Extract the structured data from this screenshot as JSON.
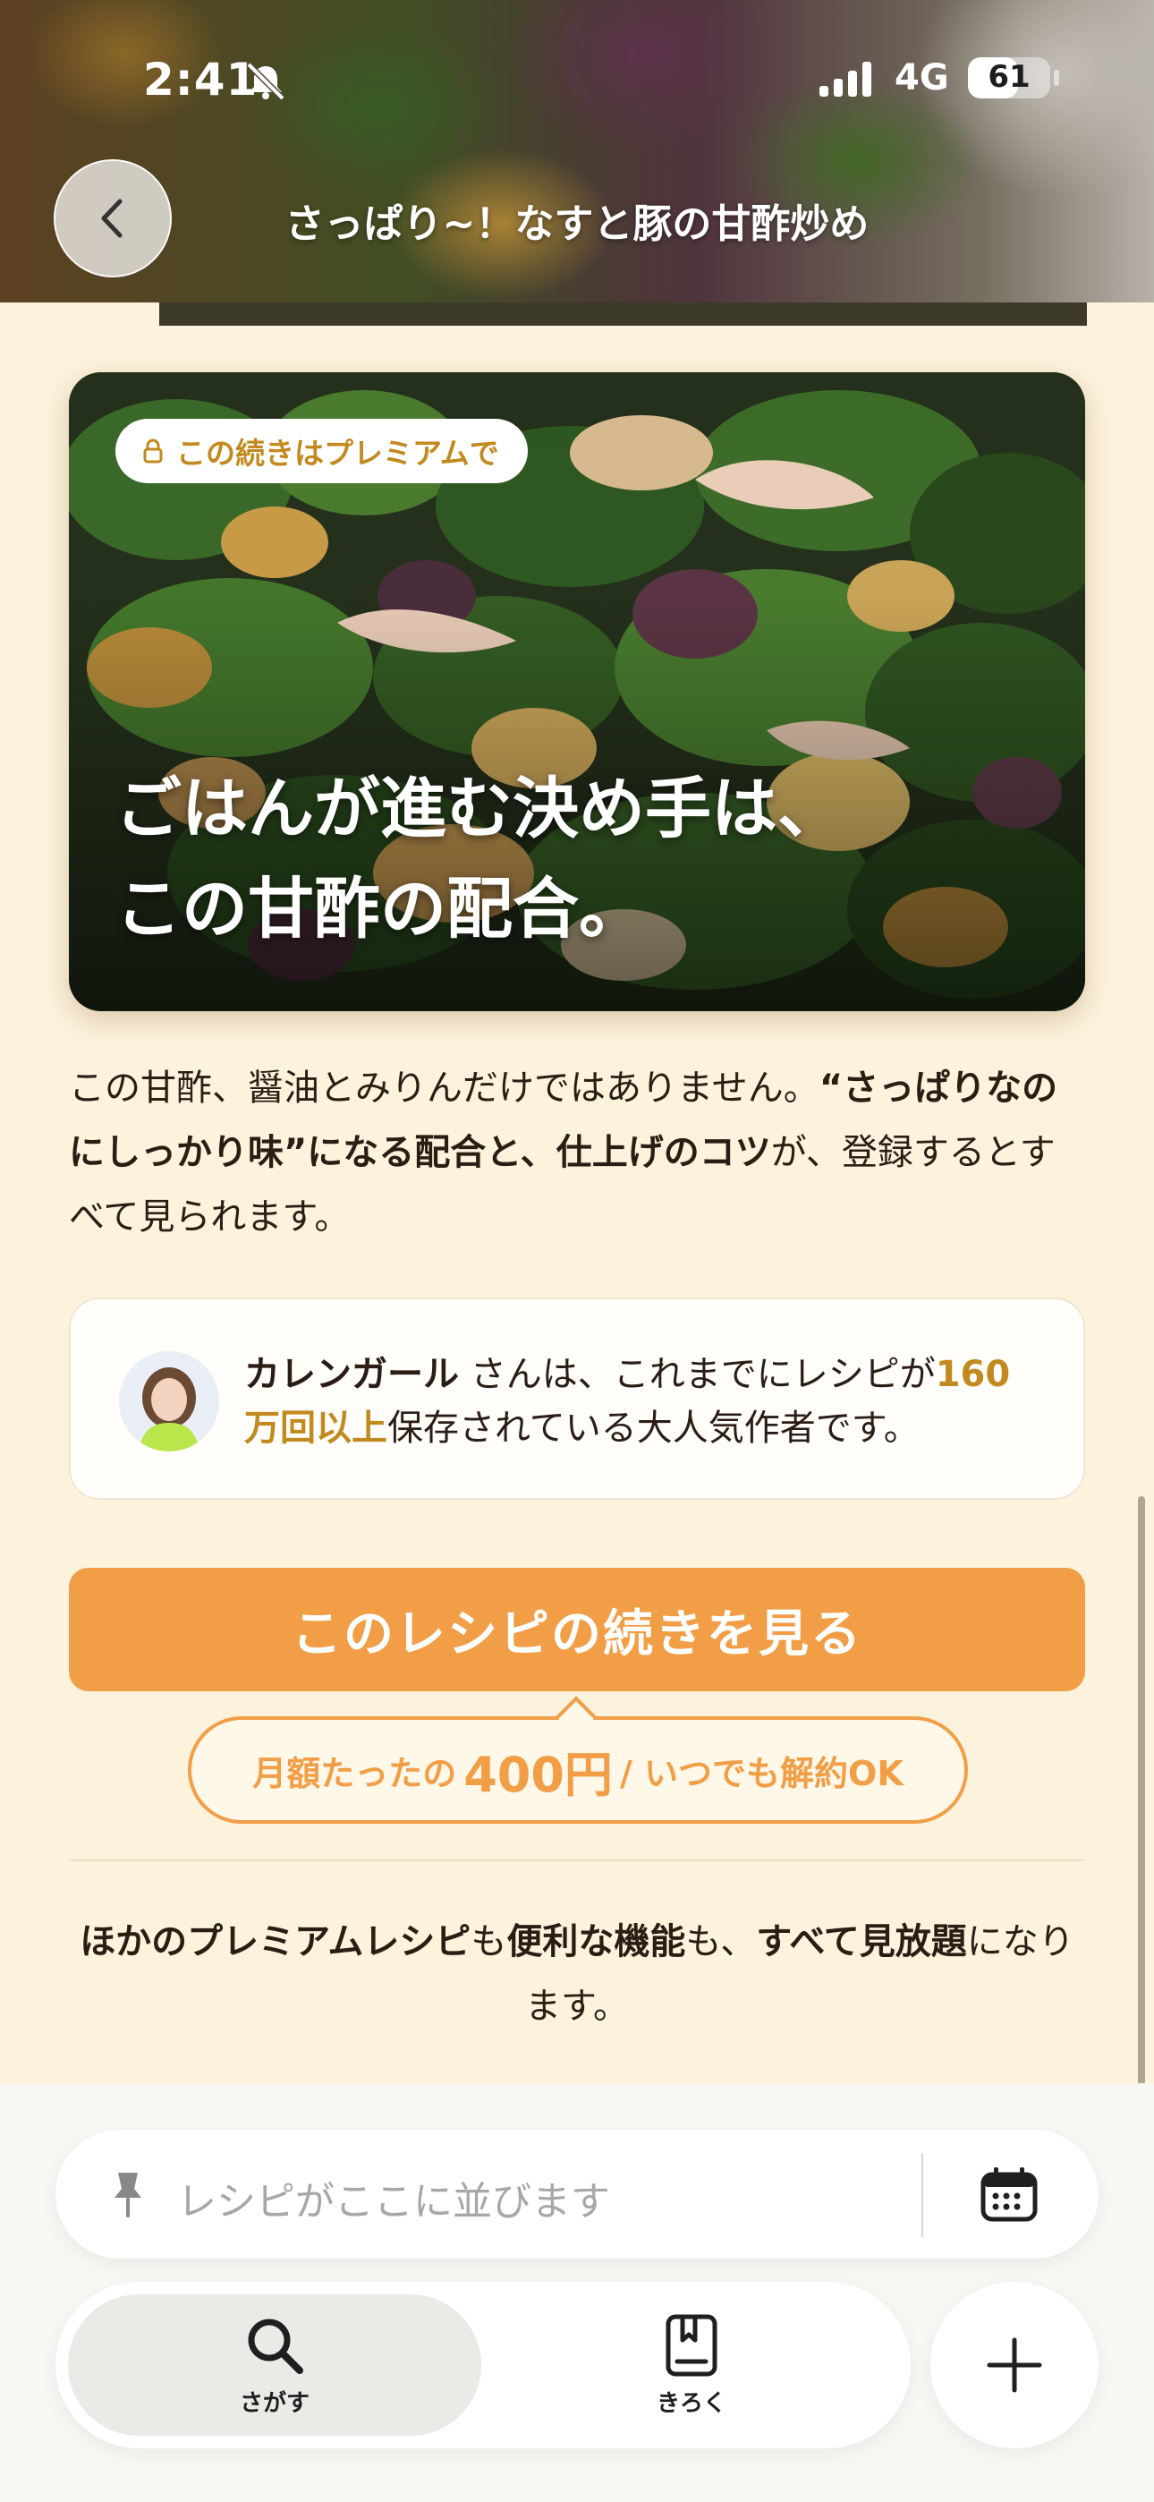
{
  "status_bar": {
    "time": "2:41",
    "network": "4G",
    "battery_level": "61",
    "battery_fraction": 0.61
  },
  "header": {
    "title": "さっぱり~！なすと豚の甘酢炒め",
    "back_icon": "chevron-left-icon"
  },
  "premium_card": {
    "badge": "この続きはプレミアムで",
    "badge_icon": "lock-icon",
    "headline_line1": "ごはんが進む決め手は、",
    "headline_line2": "この甘酢の配合。"
  },
  "description": {
    "part1": "この甘酢、醤油とみりんだけではありません。",
    "bold1": "“さっぱりなのにしっかり味”になる配合と、仕上げのコツ",
    "part2": "が、登録するとすべて見られます。"
  },
  "author": {
    "name": "カレンガール",
    "text1": " さんは、これまでにレシピが",
    "highlight": "160万回以上",
    "text2": "保存されている大人気作者です。"
  },
  "cta": {
    "label": "このレシピの続きを見る",
    "price_prefix": "月額たったの",
    "price": "400円",
    "price_suffix": " / いつでも解約OK"
  },
  "footnote": {
    "bold1": "ほかのプレミアムレシピ",
    "text1": "も",
    "bold2": "便利な機能",
    "text2": "も、",
    "bold3": "すべて見放題",
    "text3": "になります。"
  },
  "recipe_tray": {
    "placeholder": "レシピがここに並びます",
    "pin_icon": "pin-icon",
    "calendar_icon": "calendar-icon"
  },
  "tabs": [
    {
      "label": "さがす",
      "icon": "search-icon",
      "active": true
    },
    {
      "label": "きろく",
      "icon": "bookmark-book-icon",
      "active": false
    }
  ],
  "add_button_icon": "plus-icon",
  "colors": {
    "accent": "#f19e47",
    "gold": "#c28a1e",
    "background": "#fdf2dc"
  }
}
